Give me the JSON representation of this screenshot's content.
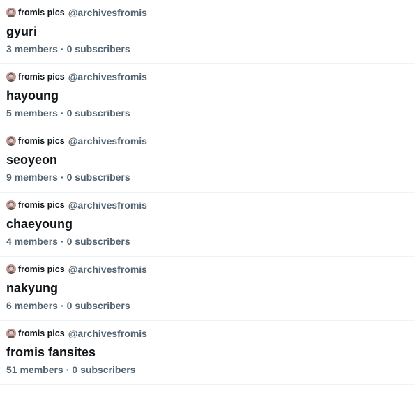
{
  "lists": [
    {
      "owner_name": "fromis pics",
      "owner_handle": "@archivesfromis",
      "name": "gyuri",
      "members": "3 members",
      "separator": "·",
      "subscribers": "0 subscribers"
    },
    {
      "owner_name": "fromis pics",
      "owner_handle": "@archivesfromis",
      "name": "hayoung",
      "members": "5 members",
      "separator": "·",
      "subscribers": "0 subscribers"
    },
    {
      "owner_name": "fromis pics",
      "owner_handle": "@archivesfromis",
      "name": "seoyeon",
      "members": "9 members",
      "separator": "·",
      "subscribers": "0 subscribers"
    },
    {
      "owner_name": "fromis pics",
      "owner_handle": "@archivesfromis",
      "name": "chaeyoung",
      "members": "4 members",
      "separator": "·",
      "subscribers": "0 subscribers"
    },
    {
      "owner_name": "fromis pics",
      "owner_handle": "@archivesfromis",
      "name": "nakyung",
      "members": "6 members",
      "separator": "·",
      "subscribers": "0 subscribers"
    },
    {
      "owner_name": "fromis pics",
      "owner_handle": "@archivesfromis",
      "name": "fromis fansites",
      "members": "51 members",
      "separator": "·",
      "subscribers": "0 subscribers"
    }
  ],
  "colors": {
    "text_primary": "#0f1419",
    "text_secondary": "#536471",
    "divider": "#eff3f4"
  },
  "icons": {
    "avatar": "avatar-photo-icon"
  }
}
